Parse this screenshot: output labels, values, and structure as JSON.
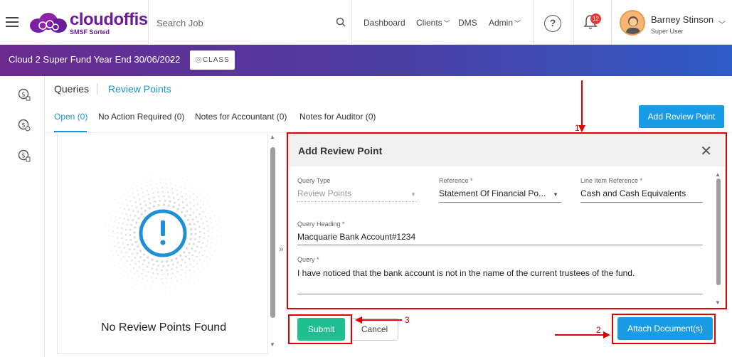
{
  "header": {
    "logo_text": "cloudoffis",
    "logo_sub": "SMSF Sorted",
    "search_placeholder": "Search Job",
    "nav": [
      {
        "label": "Dashboard",
        "has_chevron": false
      },
      {
        "label": "Clients",
        "has_chevron": true
      },
      {
        "label": "DMS",
        "has_chevron": false
      },
      {
        "label": "Admin",
        "has_chevron": true
      }
    ],
    "help_glyph": "?",
    "notifications_count": "12",
    "user_name": "Barney Stinson",
    "user_role": "Super User"
  },
  "banner": {
    "title": "Cloud 2 Super Fund Year End 30/06/2022",
    "class_logo": "CLASS"
  },
  "tabs": {
    "queries": "Queries",
    "review_points": "Review Points"
  },
  "subtabs": [
    "Open (0)",
    "No Action Required (0)",
    "Notes for Accountant (0)",
    "Notes for Auditor (0)"
  ],
  "add_review_point_label": "Add Review Point",
  "empty_state": "No Review Points Found",
  "form": {
    "title": "Add Review Point",
    "query_type_label": "Query Type",
    "query_type_value": "Review Points",
    "reference_label": "Reference *",
    "reference_value": "Statement Of Financial Po...",
    "line_item_label": "Line Item Reference *",
    "line_item_value": "Cash and Cash Equivalents",
    "heading_label": "Query Heading *",
    "heading_value": "Macquarie Bank Account#1234",
    "query_label": "Query *",
    "query_value": "I have noticed that the bank account is not in the name of the current trustees of the fund."
  },
  "buttons": {
    "submit": "Submit",
    "cancel": "Cancel",
    "attach": "Attach Document(s)"
  },
  "annotations": [
    "1",
    "2",
    "3"
  ],
  "colors": {
    "brand": "#6a1b9a",
    "accent": "#1a9be6",
    "submit": "#1fbf8f",
    "annotation": "#e00000"
  }
}
